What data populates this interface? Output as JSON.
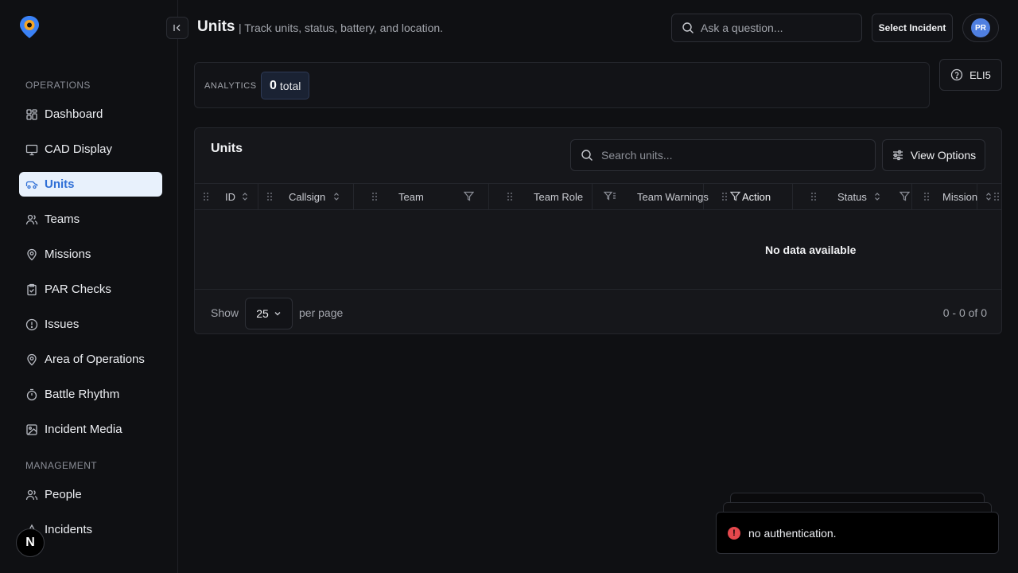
{
  "sidebar": {
    "operations_label": "OPERATIONS",
    "management_label": "MANAGEMENT",
    "operations": [
      {
        "label": "Dashboard",
        "icon": "grid-icon"
      },
      {
        "label": "CAD Display",
        "icon": "monitor-icon"
      },
      {
        "label": "Units",
        "icon": "truck-icon",
        "active": true
      },
      {
        "label": "Teams",
        "icon": "users-icon"
      },
      {
        "label": "Missions",
        "icon": "map-pin-icon"
      },
      {
        "label": "PAR Checks",
        "icon": "clipboard-check-icon"
      },
      {
        "label": "Issues",
        "icon": "alert-circle-icon"
      },
      {
        "label": "Area of Operations",
        "icon": "map-pin-icon"
      },
      {
        "label": "Battle Rhythm",
        "icon": "timer-icon"
      },
      {
        "label": "Incident Media",
        "icon": "image-icon"
      }
    ],
    "management": [
      {
        "label": "People",
        "icon": "users-icon"
      },
      {
        "label": "Incidents",
        "icon": "alert-triangle-icon"
      }
    ],
    "n_badge": "N",
    "accent": "#2f6fd6"
  },
  "header": {
    "title": "Units",
    "subtitle": "| Track units, status, battery, and location.",
    "ask_placeholder": "Ask a question...",
    "select_incident": "Select Incident",
    "avatar_initials": "PR"
  },
  "analytics": {
    "label": "ANALYTICS",
    "total_count": "0",
    "total_label": "total"
  },
  "eli5_label": "ELI5",
  "units_panel": {
    "title": "Units",
    "search_placeholder": "Search units...",
    "view_options": "View Options",
    "columns": {
      "id": "ID",
      "callsign": "Callsign",
      "team": "Team",
      "team_role": "Team Role",
      "team_warnings": "Team Warnings",
      "action": "Action",
      "status": "Status",
      "mission": "Mission"
    },
    "empty_message": "No data available",
    "show_label": "Show",
    "per_page_value": "25",
    "per_page_label": "per page",
    "range_label": "0 - 0 of 0"
  },
  "toast": {
    "message": "no authentication.",
    "status_color": "#e5484d"
  }
}
